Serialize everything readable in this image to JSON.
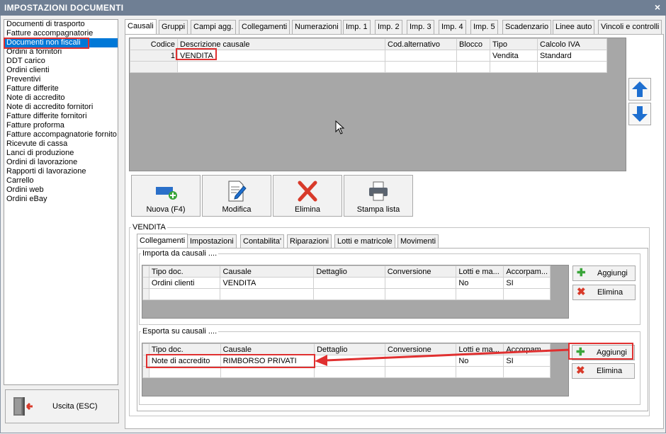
{
  "window": {
    "title": "IMPOSTAZIONI DOCUMENTI",
    "close": "×"
  },
  "left_list": [
    "Documenti di trasporto",
    "Fatture accompagnatorie",
    "Documenti non fiscali",
    "Ordini a fornitori",
    "DDT carico",
    "Ordini clienti",
    "Preventivi",
    "Fatture differite",
    "Note di accredito",
    "Note di accredito fornitori",
    "Fatture differite fornitori",
    "Fatture proforma",
    "Fatture accompagnatorie fornito",
    "Ricevute di cassa",
    "Lanci di produzione",
    "Ordini di lavorazione",
    "Rapporti di lavorazione",
    "Carrello",
    "Ordini web",
    "Ordini eBay"
  ],
  "exit_label": "Uscita (ESC)",
  "tabs": [
    "Causali",
    "Gruppi",
    "Campi agg.",
    "Collegamenti",
    "Numerazioni",
    "Imp. 1",
    "Imp. 2",
    "Imp. 3",
    "Imp. 4",
    "Imp. 5",
    "Scadenzario",
    "Linee auto",
    "Vincoli e controlli"
  ],
  "causali_grid": {
    "headers": [
      "Codice",
      "Descrizione causale",
      "Cod.alternativo",
      "Blocco",
      "Tipo",
      "Calcolo IVA"
    ],
    "rows": [
      [
        "1",
        "VENDITA",
        "",
        "",
        "Vendita",
        "Standard"
      ]
    ]
  },
  "buttons": {
    "new": "Nuova (F4)",
    "edit": "Modifica",
    "delete": "Elimina",
    "print": "Stampa lista"
  },
  "detail": {
    "title": "VENDITA",
    "subtabs": [
      "Collegamenti",
      "Impostazioni",
      "Contabilita'",
      "Riparazioni",
      "Lotti e matricole",
      "Movimenti"
    ],
    "import_group": {
      "title": "Importa da causali ....",
      "headers": [
        "Tipo doc.",
        "Causale",
        "Dettaglio",
        "Conversione",
        "Lotti e ma...",
        "Accorpam..."
      ],
      "rows": [
        [
          "Ordini clienti",
          "VENDITA",
          "",
          "",
          "No",
          "SI"
        ]
      ],
      "add": "Aggiungi",
      "remove": "Elimina"
    },
    "export_group": {
      "title": "Esporta su causali ....",
      "headers": [
        "Tipo doc.",
        "Causale",
        "Dettaglio",
        "Conversione",
        "Lotti e ma...",
        "Accorpam..."
      ],
      "rows": [
        [
          "Note di accredito",
          "RIMBORSO PRIVATI",
          "",
          "",
          "No",
          "SI"
        ]
      ],
      "add": "Aggiungi",
      "remove": "Elimina"
    }
  },
  "colors": {
    "titlebar": "#6f7f94",
    "selection": "#0078d7",
    "highlight": "#e03030",
    "arrow_blue": "#1e6fd0",
    "delete_red": "#d83a2a",
    "add_green": "#3aa53a"
  }
}
